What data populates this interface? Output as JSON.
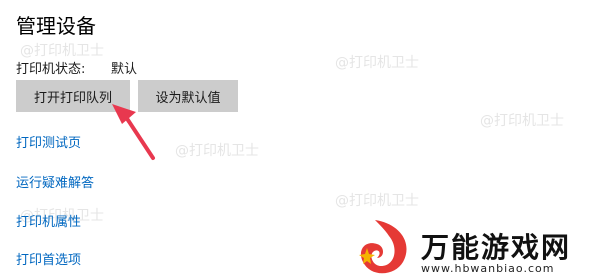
{
  "page": {
    "title": "管理设备"
  },
  "status": {
    "label": "打印机状态:",
    "value": "默认"
  },
  "buttons": {
    "open_queue": "打开打印队列",
    "set_default": "设为默认值"
  },
  "links": {
    "test_page": "打印测试页",
    "troubleshoot": "运行疑难解答",
    "properties": "打印机属性",
    "preferences": "打印首选项"
  },
  "watermark": {
    "text": "@打印机卫士"
  },
  "brand": {
    "name": "万能游戏网",
    "url": "www.hbwanbiao.com"
  },
  "colors": {
    "link": "#0067c0",
    "button_bg": "#cccccc",
    "arrow": "#e8384f",
    "logo_red": "#e53935",
    "logo_gold": "#f5b400"
  },
  "icons": {
    "annotation": "red-arrow-icon",
    "brand_logo": "brand-logo-icon"
  }
}
